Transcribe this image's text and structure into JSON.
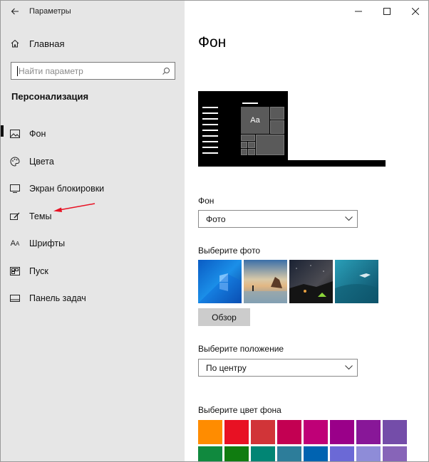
{
  "window": {
    "title": "Параметры"
  },
  "sidebar": {
    "home_label": "Главная",
    "search_placeholder": "Найти параметр",
    "section_title": "Персонализация",
    "items": [
      {
        "label": "Фон",
        "icon": "picture-icon",
        "active": true
      },
      {
        "label": "Цвета",
        "icon": "palette-icon"
      },
      {
        "label": "Экран блокировки",
        "icon": "monitor-icon"
      },
      {
        "label": "Темы",
        "icon": "brush-icon"
      },
      {
        "label": "Шрифты",
        "icon": "font-icon"
      },
      {
        "label": "Пуск",
        "icon": "start-menu-icon"
      },
      {
        "label": "Панель задач",
        "icon": "taskbar-icon"
      }
    ]
  },
  "main": {
    "page_title": "Фон",
    "preview": {
      "tile_text": "Aa"
    },
    "background": {
      "label": "Фон",
      "value": "Фото"
    },
    "choose_photo": {
      "label": "Выберите фото",
      "photos": [
        "windows-blue-wallpaper",
        "beach-rocks-sunset",
        "night-sky-tent",
        "underwater-swimmer"
      ],
      "browse_label": "Обзор"
    },
    "position": {
      "label": "Выберите положение",
      "value": "По центру"
    },
    "bg_color": {
      "label": "Выберите цвет фона",
      "colors": [
        "#ff8c00",
        "#e81123",
        "#d13438",
        "#c30052",
        "#bf0077",
        "#9a0089",
        "#881798",
        "#744da9",
        "#10893e",
        "#107c10",
        "#018574",
        "#2d7d9a",
        "#0063b1",
        "#6b69d6",
        "#8e8cd8",
        "#8764b8"
      ]
    }
  },
  "accent": "#e81123"
}
